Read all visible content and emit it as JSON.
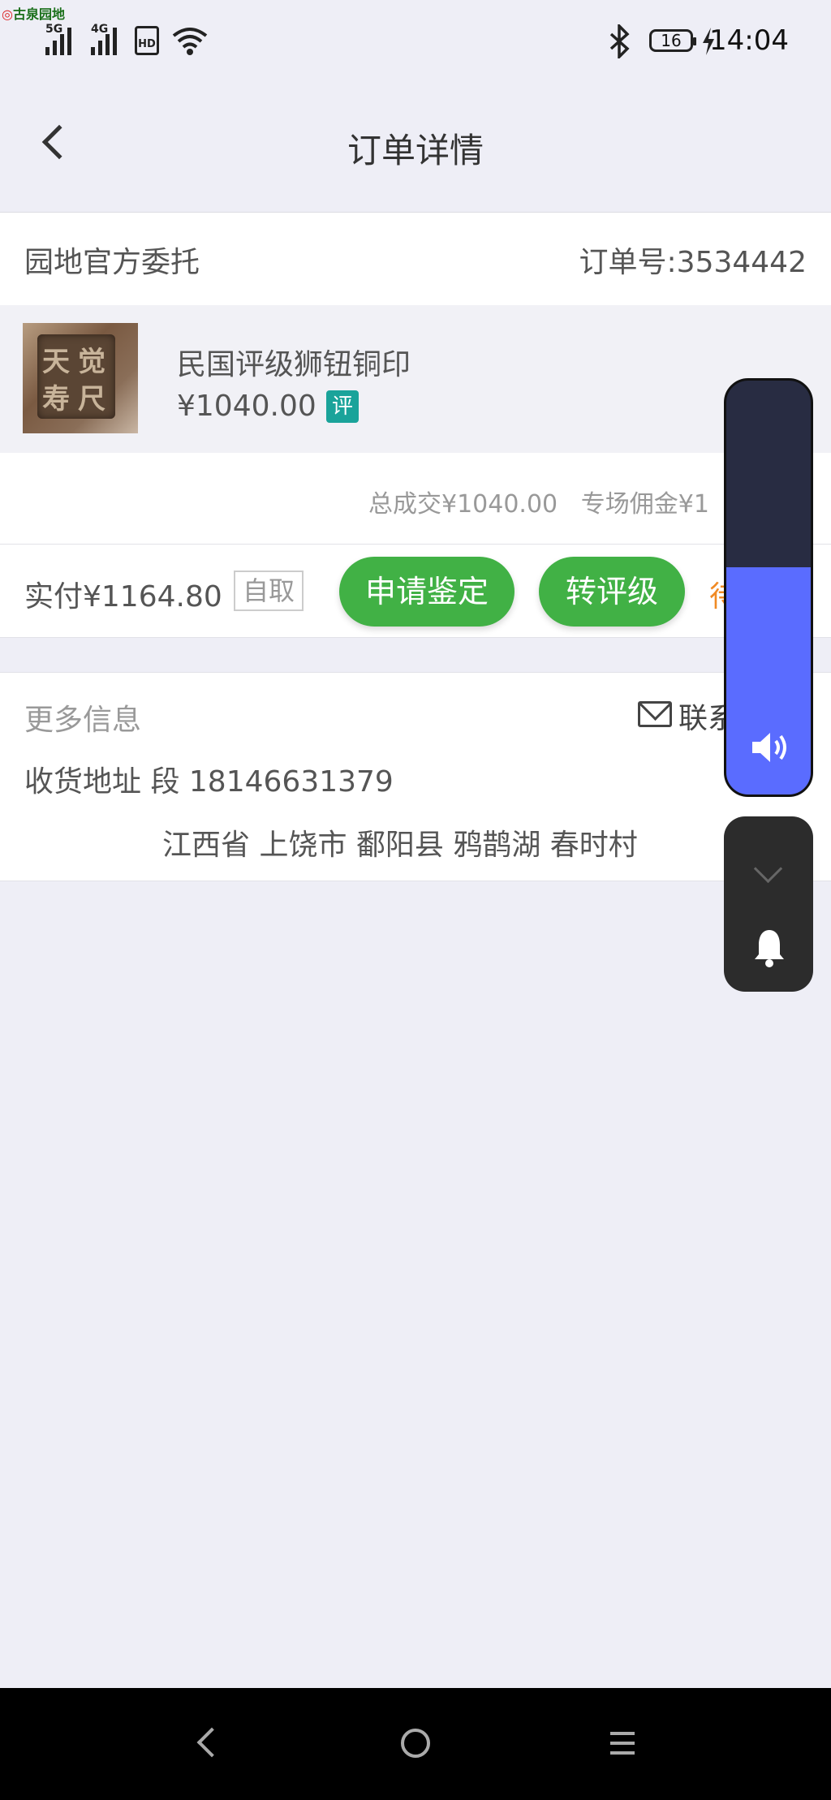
{
  "status_bar": {
    "app_watermark": "古泉园地",
    "net1": "5G",
    "net2": "4G",
    "hd": "HD",
    "battery": "16",
    "time": "14:04"
  },
  "header": {
    "title": "订单详情"
  },
  "seller": {
    "name": "园地官方委托",
    "order_no": "订单号:3534442"
  },
  "item": {
    "name": "民国评级狮钮铜印",
    "price": "¥1040.00",
    "badge": "评",
    "seal_chars": [
      "觉",
      "尺",
      "天",
      "寿"
    ]
  },
  "summary": {
    "text": "总成交¥1040.00   专场佣金¥1"
  },
  "payment": {
    "paid": "实付¥1164.80",
    "pickup": "自取",
    "btn_appraise": "申请鉴定",
    "btn_grade": "转评级",
    "status_partial": "待"
  },
  "more": {
    "label": "更多信息",
    "contact": "联系",
    "address_label": "收货地址 段 18146631379",
    "address_detail": "江西省 上饶市 鄱阳县 鸦鹊湖 春时村"
  },
  "volume": {
    "level": 0.55
  },
  "colors": {
    "green": "#41b145",
    "badge": "#1aa39a",
    "orange": "#f08a24",
    "volume": "#5a6cff"
  }
}
